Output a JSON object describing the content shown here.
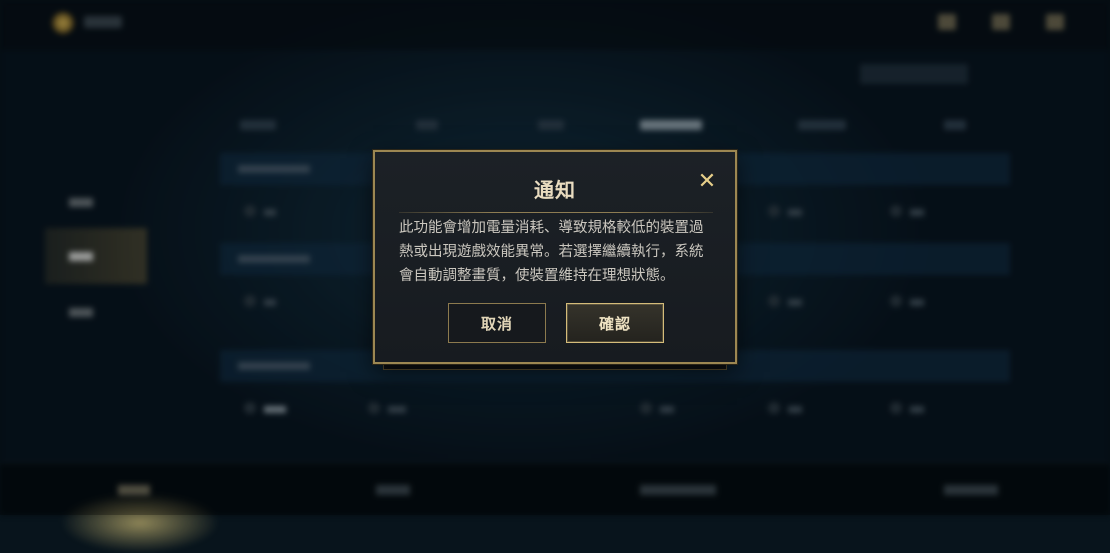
{
  "dialog": {
    "title": "通知",
    "close_icon": "close-icon",
    "message": "此功能會增加電量消耗、導致規格較低的裝置過熱或出現遊戲效能異常。若選擇繼續執行，系統會自動調整畫質，使裝置維持在理想狀態。",
    "cancel_label": "取消",
    "confirm_label": "確認"
  },
  "colors": {
    "accent_gold": "#c9aa71",
    "dialog_bg": "#1a1e23",
    "background": "#0b1a24"
  }
}
